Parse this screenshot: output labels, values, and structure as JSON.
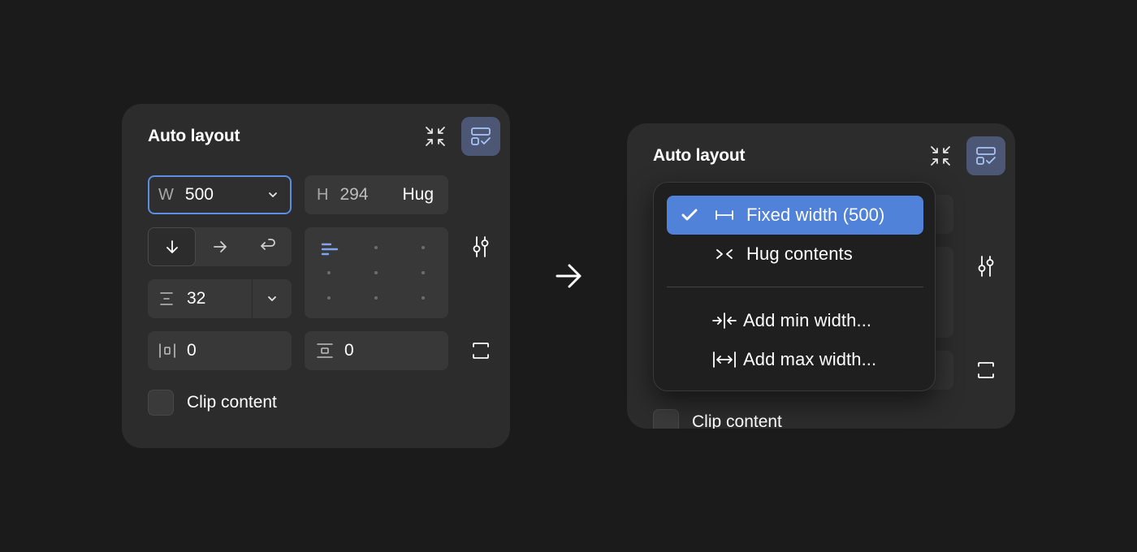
{
  "left_panel": {
    "title": "Auto layout",
    "width": {
      "label": "W",
      "value": "500"
    },
    "height": {
      "label": "H",
      "value": "294",
      "mode": "Hug"
    },
    "gap": {
      "value": "32"
    },
    "padding_horizontal": {
      "value": "0"
    },
    "padding_vertical": {
      "value": "0"
    },
    "clip_label": "Clip content"
  },
  "right_panel": {
    "title": "Auto layout",
    "clip_label": "Clip content"
  },
  "menu": {
    "items": [
      {
        "label": "Fixed width (500)",
        "selected": true
      },
      {
        "label": "Hug contents",
        "selected": false
      },
      {
        "label": "Add min width...",
        "selected": false
      },
      {
        "label": "Add max width...",
        "selected": false
      }
    ]
  },
  "colors": {
    "background": "#1b1b1b",
    "panel": "#2c2c2c",
    "field": "#383838",
    "accent": "#4f82d8",
    "focus_border": "#5c8de0",
    "active_button": "#4b5775"
  },
  "icons": {
    "collapse": "collapse-arrows-icon",
    "layout_guide": "layout-check-icon",
    "direction_down": "arrow-down-icon",
    "direction_right": "arrow-right-icon",
    "direction_wrap": "wrap-arrow-icon",
    "settings": "sliders-icon",
    "clip_frame": "frame-corners-icon",
    "next": "arrow-right-icon"
  }
}
